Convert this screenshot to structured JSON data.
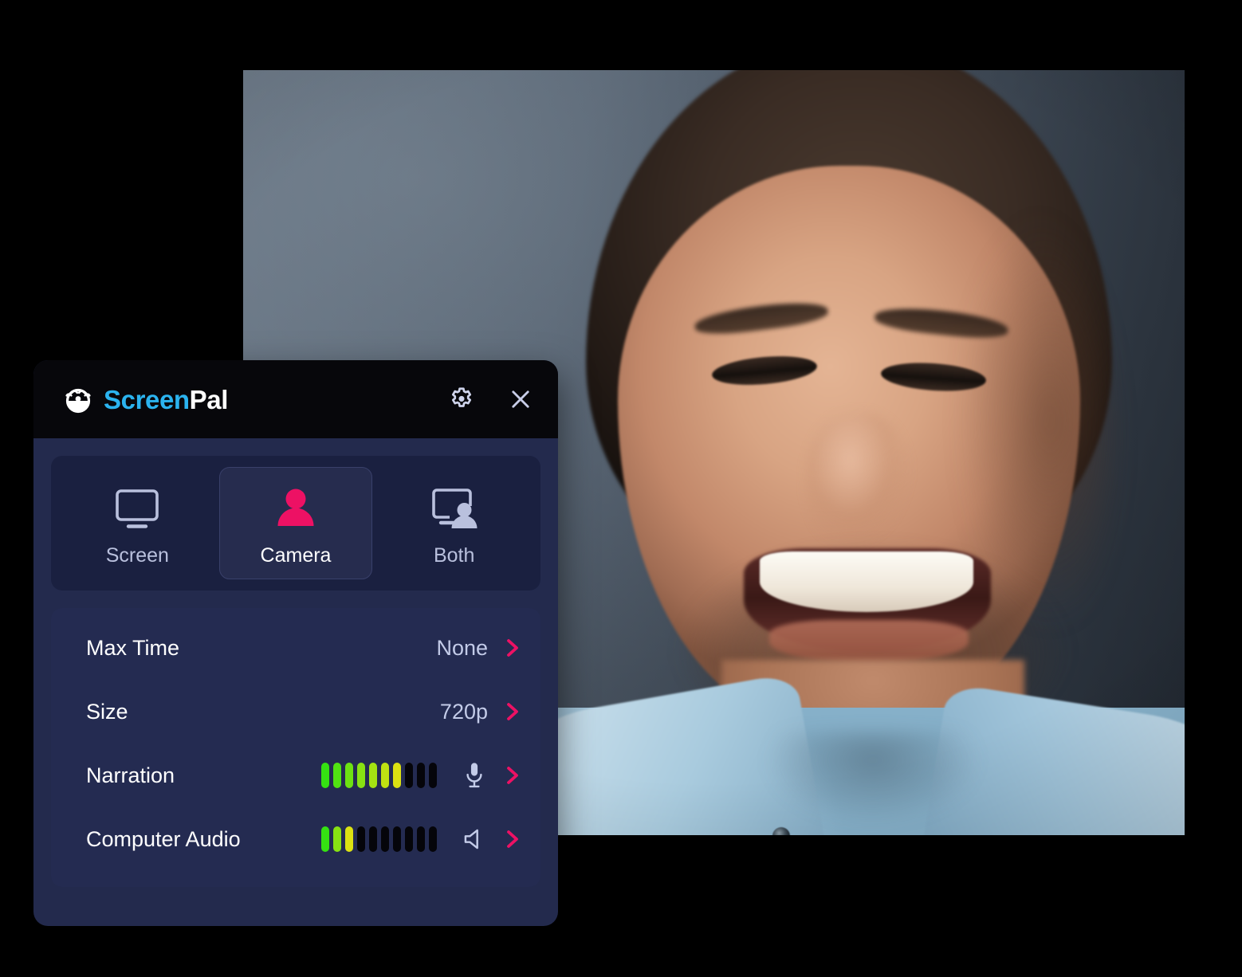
{
  "app": {
    "brand_screen": "Screen",
    "brand_pal": "Pal",
    "logo_icon": "screenpal-mascot-icon",
    "settings_icon": "gear-icon",
    "close_icon": "close-icon",
    "accent_pink": "#ED1164",
    "accent_blue": "#2BB3EF",
    "panel_bg": "#232A4D",
    "header_bg": "#07070B",
    "icon_lavender": "#B9C0DD"
  },
  "modes": {
    "selected": "Camera",
    "items": [
      {
        "label": "Screen",
        "icon": "monitor-icon",
        "selected": false
      },
      {
        "label": "Camera",
        "icon": "person-icon",
        "selected": true
      },
      {
        "label": "Both",
        "icon": "monitor-person-icon",
        "selected": false
      }
    ]
  },
  "settings": {
    "rows": [
      {
        "label": "Max Time",
        "value": "None",
        "chevron": "chevron-right-icon"
      },
      {
        "label": "Size",
        "value": "720p",
        "chevron": "chevron-right-icon"
      },
      {
        "label": "Narration",
        "meter_total": 10,
        "meter_active": 7,
        "icon": "microphone-icon",
        "chevron": "chevron-right-icon"
      },
      {
        "label": "Computer Audio",
        "meter_total": 10,
        "meter_active": 3,
        "icon": "speaker-icon",
        "chevron": "chevron-right-icon"
      }
    ]
  },
  "preview": {
    "name": "camera-preview",
    "description": "Smiling man in light blue denim shirt against a gray-blue studio backdrop"
  }
}
